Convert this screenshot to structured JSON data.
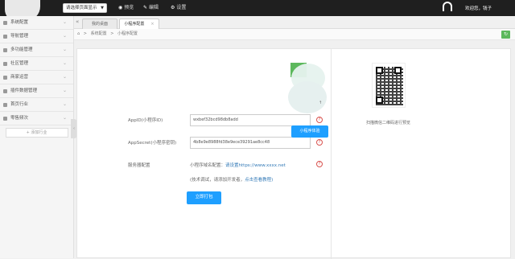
{
  "topbar": {
    "site_select": "请选择页面显示",
    "nav": [
      {
        "icon": "eye-icon",
        "glyph": "◉",
        "label": "预览"
      },
      {
        "icon": "edit-icon",
        "glyph": "✎",
        "label": "编辑"
      },
      {
        "icon": "gear-icon",
        "glyph": "⚙",
        "label": "设置"
      }
    ],
    "user_text": "欢迎您，钱子"
  },
  "sidebar": {
    "items": [
      {
        "label": "系统配置"
      },
      {
        "label": "导航管理"
      },
      {
        "label": "多功能管理"
      },
      {
        "label": "社区管理"
      },
      {
        "label": "商家运营"
      },
      {
        "label": "插件数据管理"
      },
      {
        "label": "首页行业"
      },
      {
        "label": "零售频次"
      }
    ],
    "add_label": "+ 添加行业"
  },
  "tabs": [
    {
      "label": "我的桌面",
      "active": false
    },
    {
      "label": "小程序配置",
      "active": true
    }
  ],
  "breadcrumb": {
    "home_icon": "⌂",
    "items": [
      "系统配置",
      "小程序配置"
    ],
    "separator": ">"
  },
  "form": {
    "appid_label": "AppID(小程序ID)",
    "appid_value": "wxbef32bcd98db8add",
    "secret_label": "AppSecret(小程序密钥)",
    "secret_value": "4b8e9e8988fd38e9ece39291ae8cc48",
    "server_label": "服务器配置",
    "domain_prefix": "小程序域名配置：",
    "domain_link": "请设置https://www.xxxx.net",
    "hint_prefix": "(技术调试，请添加开发者，",
    "hint_link": "点击查看教程)",
    "submit_label": "立即打包",
    "help_glyph": "?"
  },
  "preview": {
    "small_text": "↑",
    "button_label": "小程序体验",
    "qr_caption": "扫描微信二维码进行预览"
  },
  "colors": {
    "accent": "#1e9fff",
    "topbar": "#1f1f1f",
    "success": "#5cb85c",
    "danger": "#d9534f"
  }
}
